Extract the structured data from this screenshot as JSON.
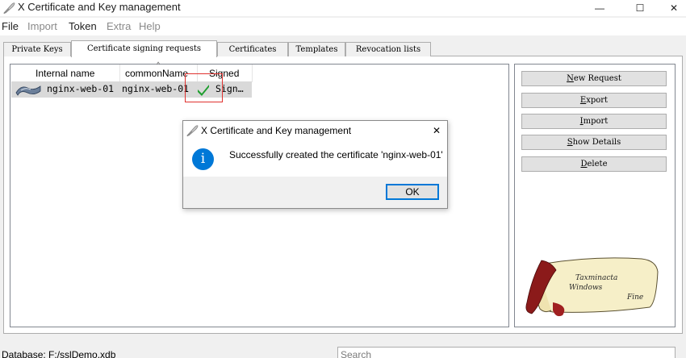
{
  "window": {
    "title": "X Certificate and Key management",
    "minimize": "—",
    "maximize": "☐",
    "close": "✕"
  },
  "menu": [
    {
      "label": "File",
      "enabled": true
    },
    {
      "label": "Import",
      "enabled": false
    },
    {
      "label": "Token",
      "enabled": true
    },
    {
      "label": "Extra",
      "enabled": false
    },
    {
      "label": "Help",
      "enabled": false
    }
  ],
  "tabs": [
    {
      "label": "Private Keys",
      "active": false
    },
    {
      "label": "Certificate signing requests",
      "active": true
    },
    {
      "label": "Certificates",
      "active": false
    },
    {
      "label": "Templates",
      "active": false
    },
    {
      "label": "Revocation lists",
      "active": false
    }
  ],
  "table": {
    "columns": [
      "Internal name",
      "commonName",
      "Signed"
    ],
    "sorted_column": "commonName",
    "rows": [
      {
        "internal_name": "nginx-web-01",
        "common_name": "nginx-web-01",
        "signed": "Sign…",
        "signed_icon": "green-checkmark-icon"
      }
    ]
  },
  "buttons": [
    {
      "label": "New Request",
      "mnemonic": "N"
    },
    {
      "label": "Export",
      "mnemonic": "E"
    },
    {
      "label": "Import",
      "mnemonic": "I"
    },
    {
      "label": "Show Details",
      "mnemonic": "S"
    },
    {
      "label": "Delete",
      "mnemonic": "D"
    }
  ],
  "scroll_image": {
    "text_line1": "Taxminacta",
    "text_line2": "Windows",
    "text_line3": "Fine"
  },
  "status": {
    "database": "Database: F:/sslDemo.xdb"
  },
  "search": {
    "placeholder": "Search"
  },
  "dialog": {
    "title": "X Certificate and Key management",
    "message": "Successfully created the certificate 'nginx-web-01'",
    "ok_label": "OK",
    "close": "✕",
    "icon": "info-icon"
  },
  "colors": {
    "accent": "#0078d7",
    "highlight_box": "#e0322f",
    "selection": "#d9d9d9"
  }
}
